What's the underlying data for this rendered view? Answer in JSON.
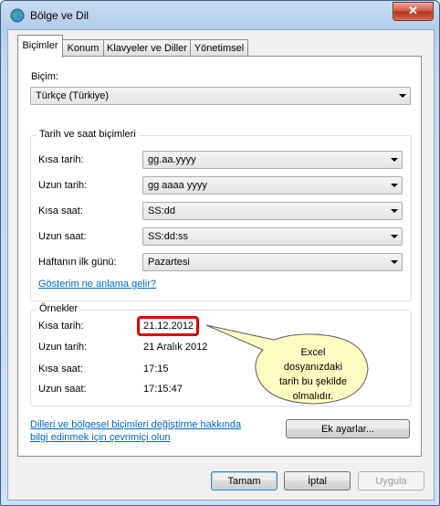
{
  "window": {
    "title": "Bölge ve Dil",
    "close_label": "✕"
  },
  "tabs": [
    {
      "label": "Biçimler",
      "active": true
    },
    {
      "label": "Konum",
      "active": false
    },
    {
      "label": "Klavyeler ve Diller",
      "active": false
    },
    {
      "label": "Yönetimsel",
      "active": false
    }
  ],
  "format": {
    "label": "Biçim:",
    "value": "Türkçe (Türkiye)"
  },
  "date_time_formats": {
    "title": "Tarih ve saat biçimleri",
    "fields": [
      {
        "label": "Kısa tarih:",
        "value": "gg.aa.yyyy"
      },
      {
        "label": "Uzun tarih:",
        "value": "gg aaaa yyyy"
      },
      {
        "label": "Kısa saat:",
        "value": "SS:dd"
      },
      {
        "label": "Uzun saat:",
        "value": "SS:dd:ss"
      },
      {
        "label": "Haftanın ilk günü:",
        "value": "Pazartesi"
      }
    ],
    "link": "Gösterim ne anlama gelir?"
  },
  "examples": {
    "title": "Örnekler",
    "rows": [
      {
        "label": "Kısa tarih:",
        "value": "21.12.2012"
      },
      {
        "label": "Uzun tarih:",
        "value": "21 Aralık 2012"
      },
      {
        "label": "Kısa saat:",
        "value": "17:15"
      },
      {
        "label": "Uzun saat:",
        "value": "17:15:47"
      }
    ]
  },
  "callout": {
    "line1": "Excel",
    "line2": "dosyanızdaki",
    "line3": "tarih bu şekilde",
    "line4": "olmalıdır."
  },
  "online_link": {
    "line1": "Dilleri ve bölgesel biçimleri değiştirme hakkında",
    "line2": "bilgi edinmek için çevrimiçi olun"
  },
  "buttons": {
    "advanced": "Ek ayarlar...",
    "ok": "Tamam",
    "cancel": "İptal",
    "apply": "Uygula"
  },
  "colors": {
    "highlight": "#e00000",
    "callout_fill": "#fffcc2",
    "link": "#0066cc"
  }
}
